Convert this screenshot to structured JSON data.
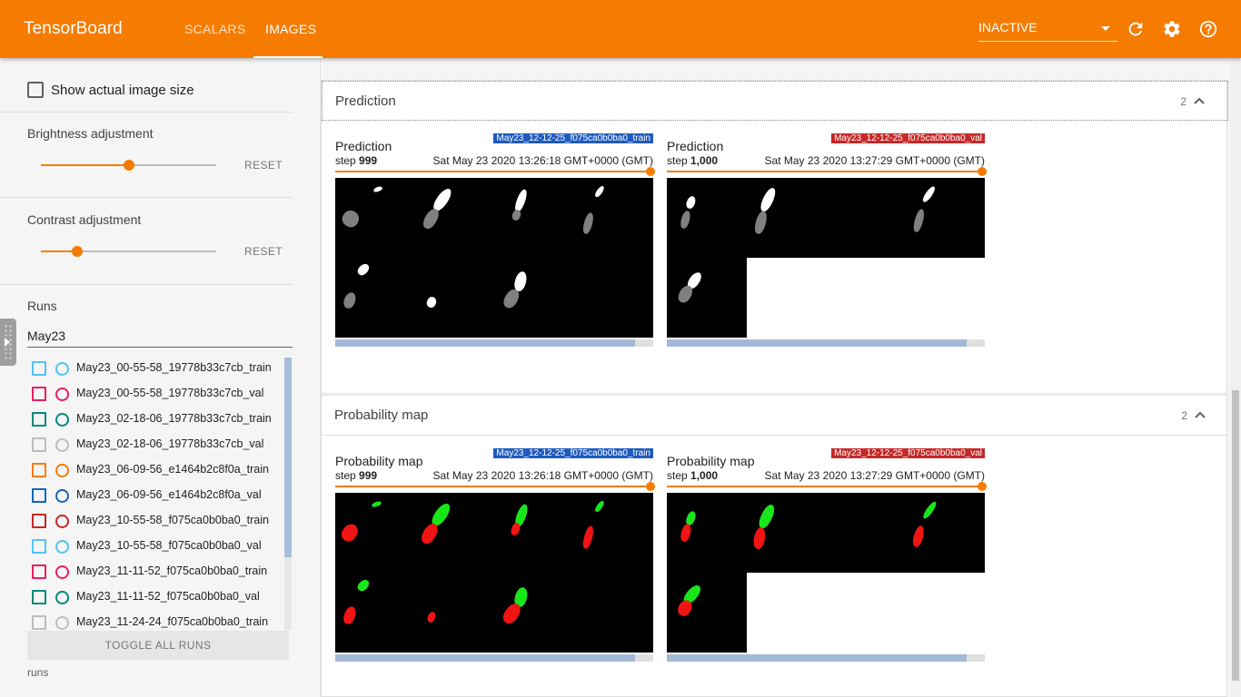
{
  "app": {
    "title": "TensorBoard"
  },
  "tabs": [
    {
      "label": "SCALARS",
      "active": false
    },
    {
      "label": "IMAGES",
      "active": true
    }
  ],
  "header": {
    "run_select_value": "INACTIVE",
    "icons": [
      "refresh-icon",
      "settings-icon",
      "help-icon"
    ]
  },
  "sidebar": {
    "show_actual_size_label": "Show actual image size",
    "brightness": {
      "label": "Brightness adjustment",
      "value": 0.5,
      "reset_label": "RESET"
    },
    "contrast": {
      "label": "Contrast adjustment",
      "value": 0.2,
      "reset_label": "RESET"
    },
    "runs_label": "Runs",
    "filter_value": "May23",
    "runs": [
      {
        "name": "May23_00-55-58_19778b33c7cb_train",
        "color": "#4fc3f7"
      },
      {
        "name": "May23_00-55-58_19778b33c7cb_val",
        "color": "#e91e63"
      },
      {
        "name": "May23_02-18-06_19778b33c7cb_train",
        "color": "#00897b"
      },
      {
        "name": "May23_02-18-06_19778b33c7cb_val",
        "color": "#bdbdbd"
      },
      {
        "name": "May23_06-09-56_e1464b2c8f0a_train",
        "color": "#f57c00"
      },
      {
        "name": "May23_06-09-56_e1464b2c8f0a_val",
        "color": "#1565c0"
      },
      {
        "name": "May23_10-55-58_f075ca0b0ba0_train",
        "color": "#c62828"
      },
      {
        "name": "May23_10-55-58_f075ca0b0ba0_val",
        "color": "#4fc3f7"
      },
      {
        "name": "May23_11-11-52_f075ca0b0ba0_train",
        "color": "#e91e63"
      },
      {
        "name": "May23_11-11-52_f075ca0b0ba0_val",
        "color": "#00897b"
      },
      {
        "name": "May23_11-24-24_f075ca0b0ba0_train",
        "color": "#bdbdbd"
      }
    ],
    "toggle_all_label": "TOGGLE ALL RUNS",
    "footer_label": "runs"
  },
  "cards": [
    {
      "title": "Prediction",
      "count": "2",
      "images": [
        {
          "title": "Prediction",
          "step_prefix": "step ",
          "step": "999",
          "date": "Sat May 23 2020 13:26:18 GMT+0000 (GMT)",
          "run_tag": "May23_12-12-25_f075ca0b0ba0_train",
          "tag_color": "#1e5bbf",
          "bar_fraction": 0.94
        },
        {
          "title": "Prediction",
          "step_prefix": "step ",
          "step": "1,000",
          "date": "Sat May 23 2020 13:27:29 GMT+0000 (GMT)",
          "run_tag": "May23_12-12-25_f075ca0b0ba0_val",
          "tag_color": "#c62828",
          "bar_fraction": 0.94
        }
      ]
    },
    {
      "title": "Probability map",
      "count": "2",
      "images": [
        {
          "title": "Probability map",
          "step_prefix": "step ",
          "step": "999",
          "date": "Sat May 23 2020 13:26:18 GMT+0000 (GMT)",
          "run_tag": "May23_12-12-25_f075ca0b0ba0_train",
          "tag_color": "#1e5bbf",
          "bar_fraction": 0.94
        },
        {
          "title": "Probability map",
          "step_prefix": "step ",
          "step": "1,000",
          "date": "Sat May 23 2020 13:27:29 GMT+0000 (GMT)",
          "run_tag": "May23_12-12-25_f075ca0b0ba0_val",
          "tag_color": "#c62828",
          "bar_fraction": 0.94
        }
      ]
    }
  ]
}
